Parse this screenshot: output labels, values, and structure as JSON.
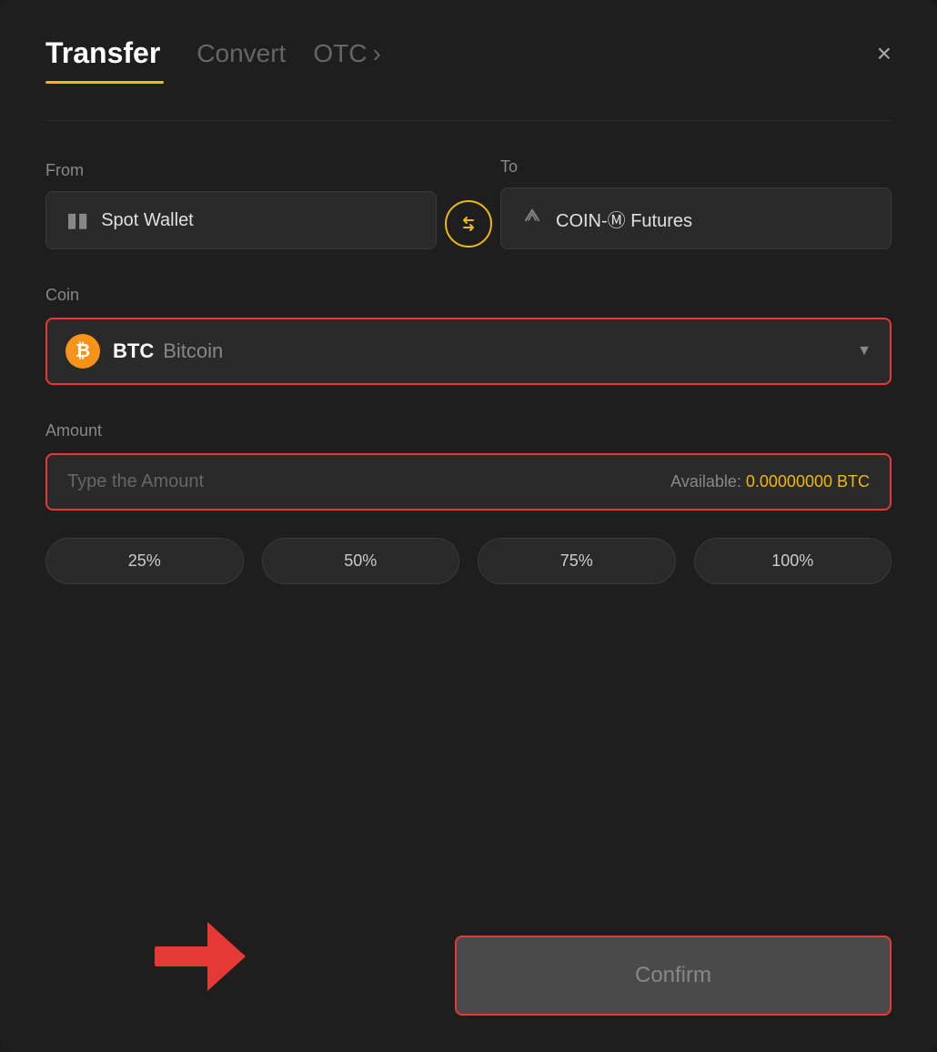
{
  "header": {
    "tab_transfer": "Transfer",
    "tab_convert": "Convert",
    "tab_otc": "OTC",
    "tab_otc_chevron": "›",
    "close_label": "×"
  },
  "from": {
    "label": "From",
    "wallet_name": "Spot Wallet"
  },
  "to": {
    "label": "To",
    "wallet_name": "COIN-Ⓜ Futures"
  },
  "coin": {
    "label": "Coin",
    "symbol": "BTC",
    "name": "Bitcoin",
    "btc_char": "₿"
  },
  "amount": {
    "label": "Amount",
    "placeholder": "Type the Amount",
    "available_label": "Available:",
    "available_value": "0.00000000 BTC"
  },
  "percentage_buttons": [
    {
      "label": "25%"
    },
    {
      "label": "50%"
    },
    {
      "label": "75%"
    },
    {
      "label": "100%"
    }
  ],
  "confirm_button": {
    "label": "Confirm"
  }
}
